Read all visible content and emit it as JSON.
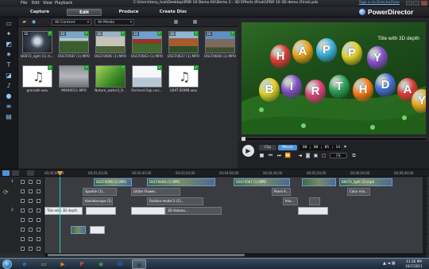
{
  "titlebar": {
    "menu": [
      "File",
      "Edit",
      "View",
      "Playback"
    ],
    "path": "C:\\Users\\tony_tsai\\Desktop\\PDR 10 Demo Kit\\Demo 2 - 3D Effects (Final)\\PDR 10 3D demo (Final).pds",
    "signin": "Sign in to DirectorZone"
  },
  "tabs": [
    {
      "label": "Capture",
      "active": false
    },
    {
      "label": "Edit",
      "active": true
    },
    {
      "label": "Produce",
      "active": false
    },
    {
      "label": "Create Disc",
      "active": false
    }
  ],
  "brand": {
    "name": "PowerDirector"
  },
  "library": {
    "filter1": "All Content",
    "filter2": "All Media",
    "items": [
      {
        "name": "B0072_light (1).m...",
        "kind": "3d-light",
        "has3d": true
      },
      {
        "name": "DSCF0587 (1).MPO",
        "kind": "temple",
        "has3d": true
      },
      {
        "name": "DSCF0606 (1).MPO",
        "kind": "statue",
        "has3d": true
      },
      {
        "name": "DSCF0663 (1).MPO",
        "kind": "courtyard",
        "has3d": true
      },
      {
        "name": "DSCF0637 (1).MPO",
        "kind": "pagoda",
        "has3d": true
      },
      {
        "name": "DSCF0608 (1).MPO",
        "kind": "tower",
        "has3d": true
      },
      {
        "name": "grenade.wav",
        "kind": "audio",
        "has3d": false
      },
      {
        "name": "IMA00011.MPO",
        "kind": "gray",
        "has3d": false
      },
      {
        "name": "Nature_water3_9...",
        "kind": "leaf",
        "has3d": false
      },
      {
        "name": "Orchard Gap unc...",
        "kind": "sky",
        "has3d": false
      },
      {
        "name": "USAT BOMB.wav",
        "kind": "audio",
        "has3d": false
      }
    ]
  },
  "preview": {
    "overlay_title": "Title with 3D depth",
    "balloon_letters_top": [
      "H",
      "A",
      "P",
      "P",
      "Y"
    ],
    "balloon_letters_bottom": [
      "B",
      "I",
      "R",
      "T",
      "H",
      "D",
      "A",
      "Y"
    ],
    "clip_label": "Clip",
    "movie_label": "Movie",
    "timecode": "00 ; 00 ; 05 ; 14",
    "fit_label": "Fit"
  },
  "timeline": {
    "ruler": [
      "00;00;00;00",
      "00;01;20;00",
      "00;02;40;00",
      "00;03;20;00",
      "00;04;00;00",
      "00;04;40;00",
      "00;05;20;00",
      "00;06;00;00",
      "00;06;40;00"
    ],
    "tracks": [
      {
        "num": "1",
        "clips": [
          {
            "label": "DSCF0606 (1).MPO",
            "type": "video",
            "start": 0.13,
            "len": 0.1
          },
          {
            "label": "DSCF0608 (1).MPO",
            "type": "video",
            "start": 0.27,
            "len": 0.18
          },
          {
            "label": "DSCF0587 (1).MPO",
            "type": "video",
            "start": 0.5,
            "len": 0.15
          },
          {
            "label": "",
            "type": "video",
            "start": 0.68,
            "len": 0.09
          },
          {
            "label": "B0072_light (1).mp4",
            "type": "video",
            "start": 0.78,
            "len": 0.14
          }
        ]
      },
      {
        "num": "",
        "clips": [
          {
            "label": "Sparkle (1)...",
            "type": "gap",
            "start": 0.1,
            "len": 0.09
          },
          {
            "label": "Glitter Flower...",
            "type": "gap",
            "start": 0.23,
            "len": 0.13
          },
          {
            "label": "Panel A...",
            "type": "gap",
            "start": 0.6,
            "len": 0.05
          },
          {
            "label": "Color mix...",
            "type": "gap",
            "start": 0.8,
            "len": 0.06
          }
        ]
      },
      {
        "num": "",
        "clips": [
          {
            "label": "Kaleidoscope (1)...",
            "type": "gap",
            "start": 0.1,
            "len": 0.08
          },
          {
            "label": "Fashion model 2 (1)...",
            "type": "gap",
            "start": 0.27,
            "len": 0.15
          },
          {
            "label": "Ima...",
            "type": "gap",
            "start": 0.63,
            "len": 0.04
          },
          {
            "label": "",
            "type": "gap",
            "start": 0.7,
            "len": 0.03
          }
        ]
      },
      {
        "num": "2",
        "clips": [
          {
            "label": "Title with 3D depth",
            "type": "white",
            "start": 0.0,
            "len": 0.1
          },
          {
            "label": "",
            "type": "white",
            "start": 0.11,
            "len": 0.08
          },
          {
            "label": "",
            "type": "white",
            "start": 0.23,
            "len": 0.09
          },
          {
            "label": "3D Volume...",
            "type": "gap",
            "start": 0.32,
            "len": 0.15
          },
          {
            "label": "",
            "type": "white",
            "start": 0.67,
            "len": 0.08
          }
        ]
      },
      {
        "num": "",
        "clips": []
      },
      {
        "num": "",
        "clips": [
          {
            "label": "",
            "type": "video",
            "start": 0.07,
            "len": 0.04
          },
          {
            "label": "",
            "type": "white",
            "start": 0.12,
            "len": 0.04
          }
        ]
      },
      {
        "num": "",
        "clips": []
      },
      {
        "num": "",
        "clips": []
      }
    ]
  },
  "taskbar": {
    "apps": [
      "e",
      "folder",
      "player",
      "ppt-orange",
      "chrome",
      "word",
      "pdr"
    ],
    "time": "11:26 PM",
    "date": "10/7/2011"
  }
}
